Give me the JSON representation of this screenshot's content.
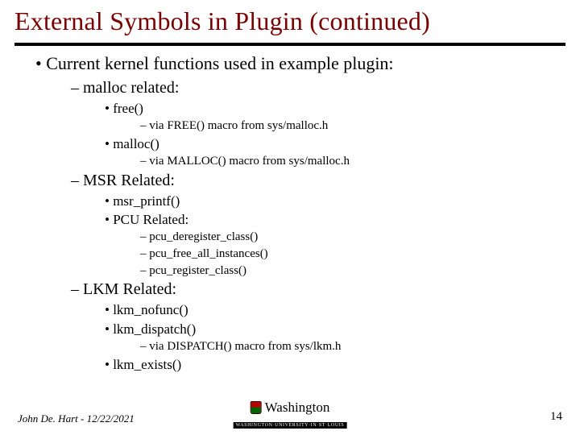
{
  "title": "External Symbols in Plugin (continued)",
  "bullets": {
    "l1_intro": "Current kernel functions used in example plugin:",
    "l2_malloc": "malloc related:",
    "l3_free": "free()",
    "l4_free_via": "via FREE() macro from sys/malloc.h",
    "l3_malloc": "malloc()",
    "l4_malloc_via": "via MALLOC() macro from sys/malloc.h",
    "l2_msr": "MSR Related:",
    "l3_msr_printf": "msr_printf()",
    "l3_pcu": "PCU Related:",
    "l4_pcu_dereg": "pcu_deregister_class()",
    "l4_pcu_free": "pcu_free_all_instances()",
    "l4_pcu_reg": "pcu_register_class()",
    "l2_lkm": "LKM Related:",
    "l3_lkm_nofunc": "lkm_nofunc()",
    "l3_lkm_dispatch": "lkm_dispatch()",
    "l4_lkm_dispatch_via": "via DISPATCH() macro from sys/lkm.h",
    "l3_lkm_exists": "lkm_exists()"
  },
  "footer": {
    "author_date": "John De. Hart - 12/22/2021",
    "org": "Washington",
    "org_sub": "WASHINGTON·UNIVERSITY·IN·ST·LOUIS",
    "page": "14"
  }
}
